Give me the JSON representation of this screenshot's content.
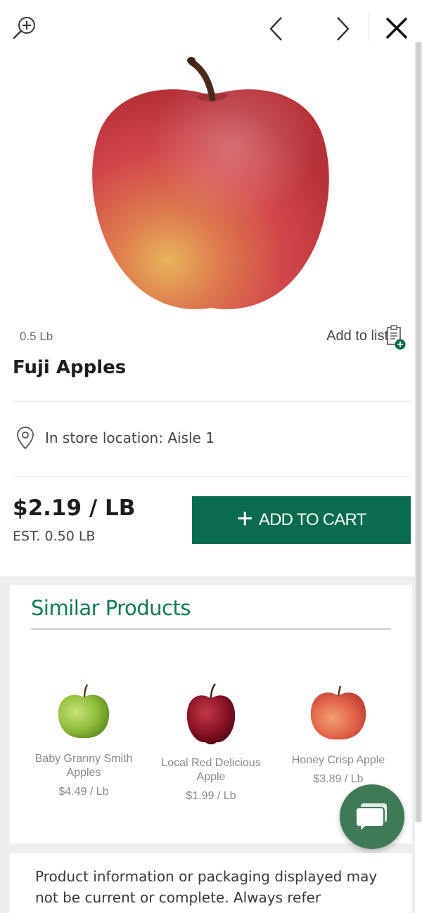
{
  "colors": {
    "brand_green": "#0b6b4f",
    "similar_title_green": "#0b7a56",
    "chat_green": "#3f7a57"
  },
  "toolbar": {
    "zoom_icon": "zoom-in-icon",
    "prev_icon": "chevron-left-icon",
    "next_icon": "chevron-right-icon",
    "close_icon": "close-icon"
  },
  "product": {
    "weight": "0.5 Lb",
    "add_to_list": "Add to list",
    "name": "Fuji Apples",
    "location": "In store location: Aisle 1",
    "price": "$2.19 / LB",
    "estimate": "EST. 0.50 LB",
    "add_to_cart": "ADD TO CART"
  },
  "similar": {
    "title": "Similar Products",
    "items": [
      {
        "name": "Baby Granny Smith Apples",
        "price": "$4.49 / Lb"
      },
      {
        "name": "Local Red Delicious Apple",
        "price": "$1.99 / Lb"
      },
      {
        "name": "Honey Crisp Apple",
        "price": "$3.89 / Lb"
      }
    ]
  },
  "disclaimer": "Product information or packaging displayed may not be current or complete. Always refer"
}
